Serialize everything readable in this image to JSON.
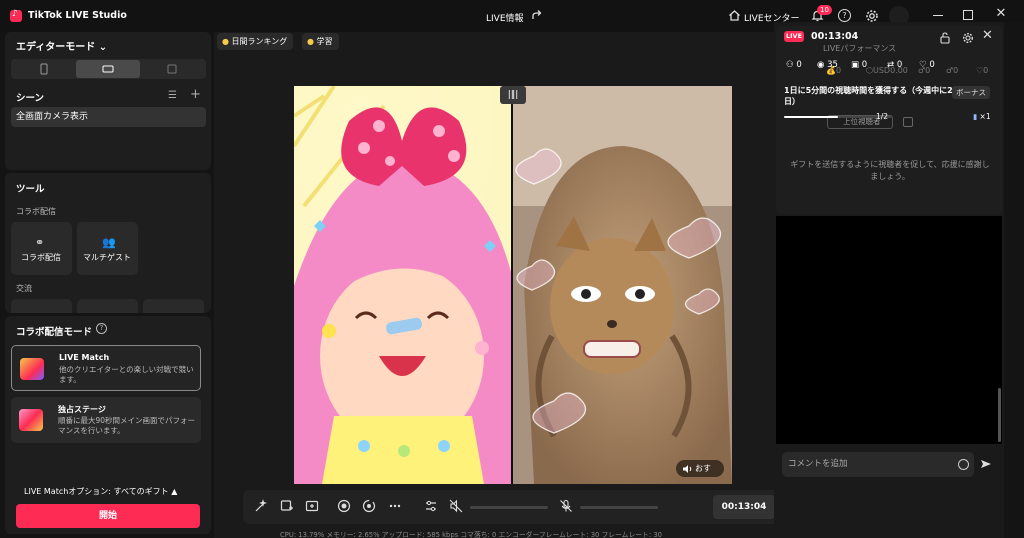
{
  "app": {
    "title": "TikTok LIVE Studio",
    "live_info": "LIVE情報",
    "live_center": "LIVEセンター",
    "notification_count": "10"
  },
  "left": {
    "editor_mode": "エディターモード ⌄",
    "scene_title": "シーン",
    "scenes": [
      "全画面カメラ表示"
    ],
    "tools_title": "ツール",
    "collab_label": "コラボ配信",
    "tools": [
      {
        "icon": "link-icon",
        "label": "コラボ配信"
      },
      {
        "icon": "multi-guest-icon",
        "label": "マルチゲスト"
      }
    ],
    "exchange_label": "交流",
    "collab_mode_title": "コラボ配信モード",
    "modes": [
      {
        "name": "LIVE Match",
        "desc": "他のクリエイターとの楽しい対戦で競います。"
      },
      {
        "name": "独占ステージ",
        "desc": "順番に最大90秒間メイン画面でパフォーマンスを行います。"
      }
    ],
    "live_match_option": "LIVE Matchオプション: すべてのギフト ▲",
    "start_label": "開始"
  },
  "center": {
    "chips": [
      "日間ランキング",
      "学習"
    ],
    "volume_label": "おす",
    "timer": "00:13:04",
    "stats": "CPU: 13.79%    メモリー: 2.65%    アップロード: 585 kbps    コマ落ち: 0    エンコーダーフレームレート: 30    フレームレート: 30"
  },
  "right": {
    "live_badge": "LIVE",
    "timer": "00:13:04",
    "perf_label": "LIVEパフォーマンス",
    "metrics": [
      "0",
      "35",
      "0",
      "0",
      "0"
    ],
    "ghost_metrics": [
      "0",
      "USD0.00",
      "0",
      "0",
      "0"
    ],
    "goal_text": "1日に5分間の視聴時間を獲得する（今週中に2日）",
    "bonus": "ボーナス",
    "goal_progress": 0.5,
    "progress_text": "1/2",
    "top_viewers": "上位視聴者",
    "count_x1": "×1",
    "hint": "ギフトを送信するように視聴者を促して、応援に感謝しましょう。",
    "comment_placeholder": "コメントを追加"
  },
  "colors": {
    "accent": "#fe2c55"
  }
}
